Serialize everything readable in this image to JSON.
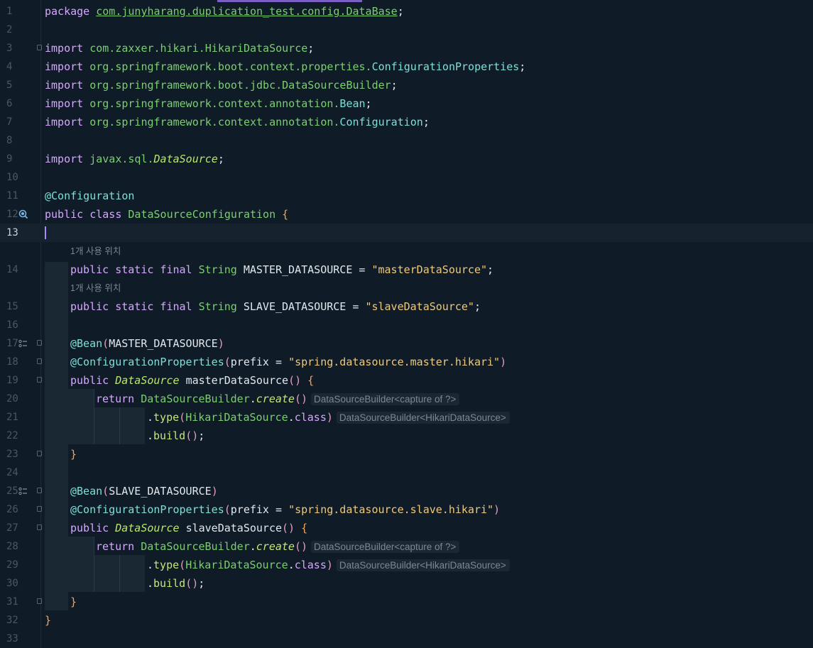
{
  "editor": {
    "current_line": 13,
    "code_lines": [
      {
        "n": "1",
        "tokens": [
          [
            "kw",
            "package "
          ],
          [
            "pkgu",
            "com.junyharang.duplication_test.config.DataBase"
          ],
          [
            "txt",
            ";"
          ]
        ]
      },
      {
        "n": "2",
        "tokens": []
      },
      {
        "n": "3",
        "tokens": [
          [
            "kw",
            "import "
          ],
          [
            "pkg",
            "com.zaxxer.hikari.HikariDataSource"
          ],
          [
            "txt",
            ";"
          ]
        ]
      },
      {
        "n": "4",
        "tokens": [
          [
            "kw",
            "import "
          ],
          [
            "pkg",
            "org.springframework.boot.context.properties."
          ],
          [
            "cls",
            "ConfigurationProperties"
          ],
          [
            "txt",
            ";"
          ]
        ]
      },
      {
        "n": "5",
        "tokens": [
          [
            "kw",
            "import "
          ],
          [
            "pkg",
            "org.springframework.boot.jdbc.DataSourceBuilder"
          ],
          [
            "txt",
            ";"
          ]
        ]
      },
      {
        "n": "6",
        "tokens": [
          [
            "kw",
            "import "
          ],
          [
            "pkg",
            "org.springframework.context.annotation."
          ],
          [
            "cls",
            "Bean"
          ],
          [
            "txt",
            ";"
          ]
        ]
      },
      {
        "n": "7",
        "tokens": [
          [
            "kw",
            "import "
          ],
          [
            "pkg",
            "org.springframework.context.annotation."
          ],
          [
            "cls",
            "Configuration"
          ],
          [
            "txt",
            ";"
          ]
        ]
      },
      {
        "n": "8",
        "tokens": []
      },
      {
        "n": "9",
        "tokens": [
          [
            "kw",
            "import "
          ],
          [
            "pkg",
            "javax.sql."
          ],
          [
            "clsi",
            "DataSource"
          ],
          [
            "txt",
            ";"
          ]
        ]
      },
      {
        "n": "10",
        "tokens": []
      },
      {
        "n": "11",
        "tokens": [
          [
            "ann",
            "@Configuration"
          ]
        ]
      },
      {
        "n": "12",
        "tokens": [
          [
            "kw",
            "public class "
          ],
          [
            "type",
            "DataSourceConfiguration "
          ],
          [
            "brc",
            "{"
          ]
        ]
      },
      {
        "n": "13",
        "tokens": []
      },
      {
        "n": "14",
        "tokens": [
          [
            "kw",
            "public static final "
          ],
          [
            "type",
            "String "
          ],
          [
            "txt",
            "MASTER_DATASOURCE = "
          ],
          [
            "str",
            "\"masterDataSource\""
          ],
          [
            "txt",
            ";"
          ]
        ]
      },
      {
        "n": "15",
        "tokens": [
          [
            "kw",
            "public static final "
          ],
          [
            "type",
            "String "
          ],
          [
            "txt",
            "SLAVE_DATASOURCE = "
          ],
          [
            "str",
            "\"slaveDataSource\""
          ],
          [
            "txt",
            ";"
          ]
        ]
      },
      {
        "n": "16",
        "tokens": []
      },
      {
        "n": "17",
        "tokens": [
          [
            "ann",
            "@Bean"
          ],
          [
            "par",
            "("
          ],
          [
            "txt",
            "MASTER_DATASOURCE"
          ],
          [
            "par",
            ")"
          ]
        ]
      },
      {
        "n": "18",
        "tokens": [
          [
            "ann",
            "@ConfigurationProperties"
          ],
          [
            "par",
            "("
          ],
          [
            "txt",
            "prefix = "
          ],
          [
            "str",
            "\"spring.datasource.master.hikari\""
          ],
          [
            "par",
            ")"
          ]
        ]
      },
      {
        "n": "19",
        "tokens": [
          [
            "kw",
            "public "
          ],
          [
            "clsi",
            "DataSource "
          ],
          [
            "txt",
            "masterDataSource"
          ],
          [
            "par",
            "()"
          ],
          [
            "txt",
            " "
          ],
          [
            "brc",
            "{"
          ]
        ]
      },
      {
        "n": "20",
        "tokens": [
          [
            "kw",
            "return "
          ],
          [
            "type",
            "DataSourceBuilder"
          ],
          [
            "txt",
            "."
          ],
          [
            "mthi",
            "create"
          ],
          [
            "par",
            "()"
          ]
        ],
        "inlay": "DataSourceBuilder<capture of ?>"
      },
      {
        "n": "21",
        "tokens": [
          [
            "txt",
            "."
          ],
          [
            "mth",
            "type"
          ],
          [
            "par",
            "("
          ],
          [
            "type",
            "HikariDataSource"
          ],
          [
            "txt",
            "."
          ],
          [
            "kw",
            "class"
          ],
          [
            "par",
            ")"
          ]
        ],
        "inlay": "DataSourceBuilder<HikariDataSource>"
      },
      {
        "n": "22",
        "tokens": [
          [
            "txt",
            "."
          ],
          [
            "mth",
            "build"
          ],
          [
            "par",
            "()"
          ],
          [
            "txt",
            ";"
          ]
        ]
      },
      {
        "n": "23",
        "tokens": [
          [
            "brc",
            "}"
          ]
        ]
      },
      {
        "n": "24",
        "tokens": []
      },
      {
        "n": "25",
        "tokens": [
          [
            "ann",
            "@Bean"
          ],
          [
            "par",
            "("
          ],
          [
            "txt",
            "SLAVE_DATASOURCE"
          ],
          [
            "par",
            ")"
          ]
        ]
      },
      {
        "n": "26",
        "tokens": [
          [
            "ann",
            "@ConfigurationProperties"
          ],
          [
            "par",
            "("
          ],
          [
            "txt",
            "prefix = "
          ],
          [
            "str",
            "\"spring.datasource.slave.hikari\""
          ],
          [
            "par",
            ")"
          ]
        ]
      },
      {
        "n": "27",
        "tokens": [
          [
            "kw",
            "public "
          ],
          [
            "clsi",
            "DataSource "
          ],
          [
            "txt",
            "slaveDataSource"
          ],
          [
            "par",
            "()"
          ],
          [
            "txt",
            " "
          ],
          [
            "brc",
            "{"
          ]
        ]
      },
      {
        "n": "28",
        "tokens": [
          [
            "kw",
            "return "
          ],
          [
            "type",
            "DataSourceBuilder"
          ],
          [
            "txt",
            "."
          ],
          [
            "mthi",
            "create"
          ],
          [
            "par",
            "()"
          ]
        ],
        "inlay": "DataSourceBuilder<capture of ?>"
      },
      {
        "n": "29",
        "tokens": [
          [
            "txt",
            "."
          ],
          [
            "mth",
            "type"
          ],
          [
            "par",
            "("
          ],
          [
            "type",
            "HikariDataSource"
          ],
          [
            "txt",
            "."
          ],
          [
            "kw",
            "class"
          ],
          [
            "par",
            ")"
          ]
        ],
        "inlay": "DataSourceBuilder<HikariDataSource>"
      },
      {
        "n": "30",
        "tokens": [
          [
            "txt",
            "."
          ],
          [
            "mth",
            "build"
          ],
          [
            "par",
            "()"
          ],
          [
            "txt",
            ";"
          ]
        ]
      },
      {
        "n": "31",
        "tokens": [
          [
            "brc",
            "}"
          ]
        ]
      },
      {
        "n": "32",
        "tokens": [
          [
            "brc",
            "}"
          ]
        ]
      },
      {
        "n": "33",
        "tokens": []
      }
    ],
    "usage_hints": [
      {
        "before_line": "14",
        "text": "1개 사용 위치"
      },
      {
        "before_line": "15",
        "text": "1개 사용 위치"
      }
    ],
    "gutter_icons": {
      "12": "bean-class-icon",
      "17": "bean-method-icon",
      "25": "bean-method-icon"
    },
    "fold_markers": [
      "3",
      "17",
      "18",
      "19",
      "23",
      "25",
      "26",
      "27",
      "31"
    ]
  }
}
